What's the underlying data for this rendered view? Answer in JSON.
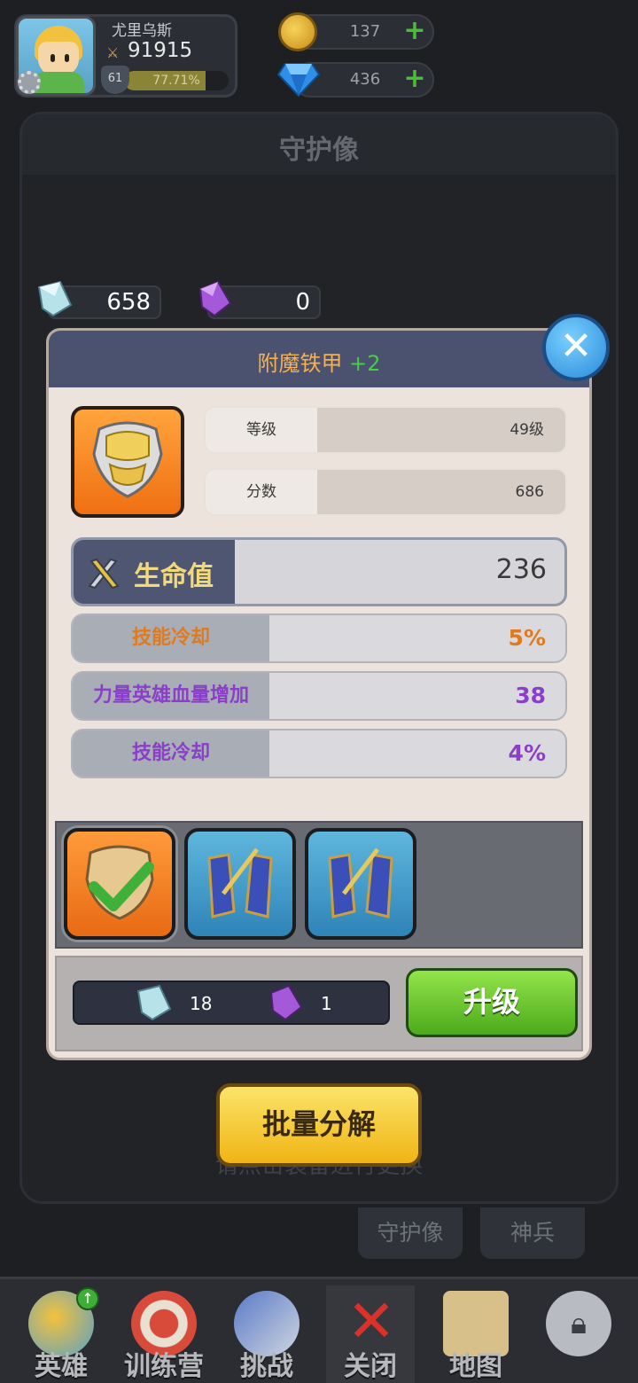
{
  "player": {
    "name": "尤里乌斯",
    "power": "91915",
    "level": "61",
    "exp_percent_text": "77.71%",
    "exp_fraction": 0.7771
  },
  "resources": {
    "coins": "137",
    "gems": "436"
  },
  "main_panel": {
    "title": "守护像",
    "hint": "请点击装备进行更换"
  },
  "crystals": {
    "blue": "658",
    "purple": "0"
  },
  "modal": {
    "title": "附魔铁甲",
    "enhance": "+2",
    "info": [
      {
        "label": "等级",
        "value": "49级"
      },
      {
        "label": "分数",
        "value": "686"
      }
    ],
    "main_stat": {
      "label": "生命值",
      "value": "236"
    },
    "sub_stats": [
      {
        "label": "技能冷却",
        "value": "5%",
        "color": "#e07a1e"
      },
      {
        "label": "力量英雄血量增加",
        "value": "38",
        "color": "#8a3fc8"
      },
      {
        "label": "技能冷却",
        "value": "4%",
        "color": "#8a3fc8"
      }
    ],
    "cost": {
      "blue": "18",
      "purple": "1"
    },
    "upgrade_label": "升级"
  },
  "decompose_label": "批量分解",
  "tabs": [
    "守护像",
    "神兵"
  ],
  "bottom_nav": [
    {
      "label": "英雄",
      "icon": "hero-icon"
    },
    {
      "label": "训练营",
      "icon": "training-camp-icon"
    },
    {
      "label": "挑战",
      "icon": "sword-shield-icon"
    },
    {
      "label": "关闭",
      "icon": "close-x-icon"
    },
    {
      "label": "地图",
      "icon": "map-icon"
    },
    {
      "label": "",
      "icon": "locked-icon"
    }
  ],
  "colors": {
    "accent_orange": "#f6b050",
    "accent_green": "#44d041",
    "stat_orange": "#e07a1e",
    "stat_purple": "#8a3fc8"
  }
}
